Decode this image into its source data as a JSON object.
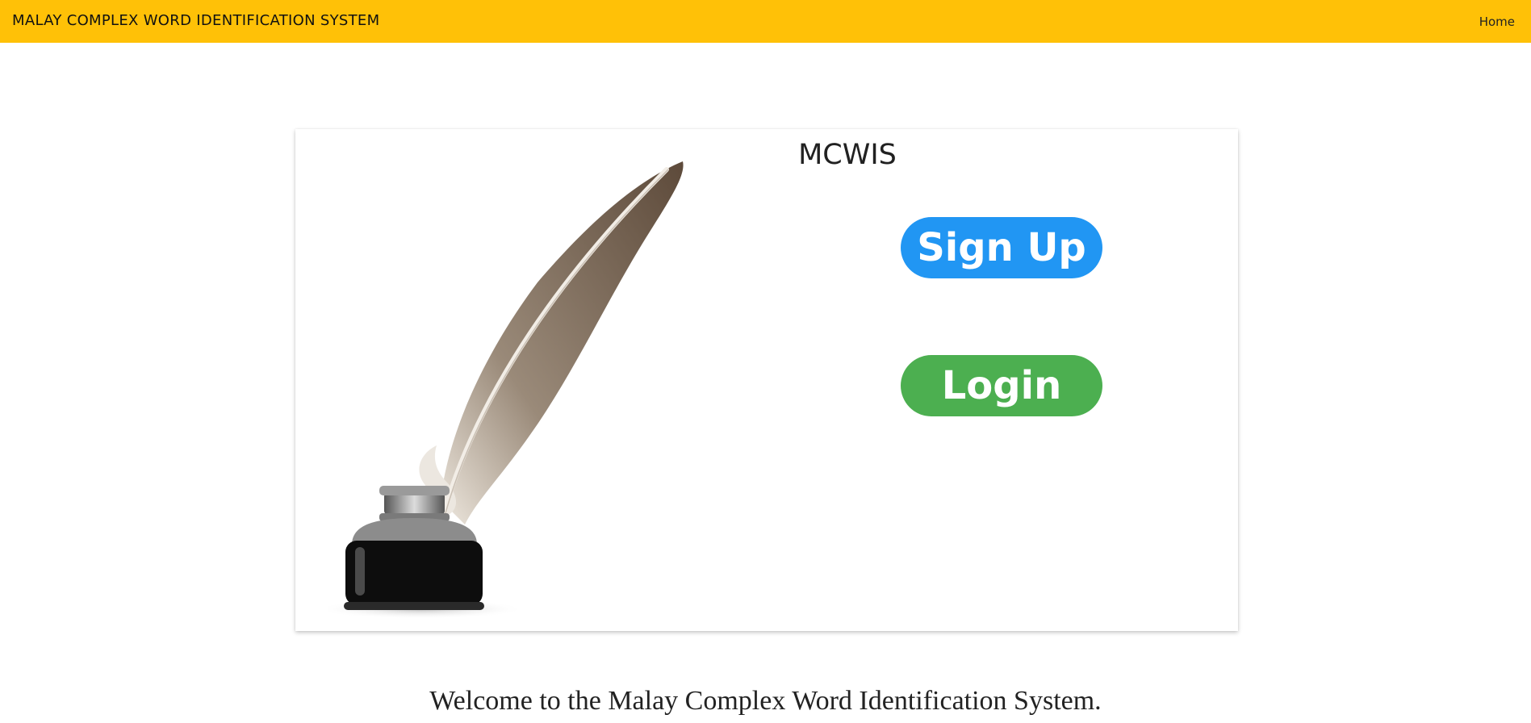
{
  "navbar": {
    "brand": "MALAY COMPLEX WORD IDENTIFICATION SYSTEM",
    "home_link": "Home",
    "background_color": "#ffc107"
  },
  "card": {
    "title": "MCWIS",
    "illustration_icon": "quill-and-inkwell",
    "signup_label": "Sign Up",
    "signup_color": "#2196f3",
    "login_label": "Login",
    "login_color": "#4caf50"
  },
  "footer": {
    "welcome": "Welcome to the Malay Complex Word Identification System."
  }
}
